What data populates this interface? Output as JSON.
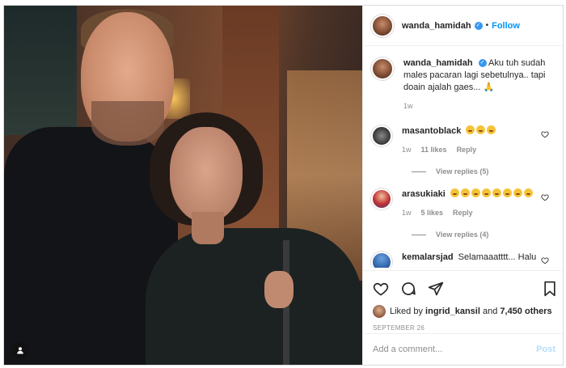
{
  "post": {
    "username": "wanda_hamidah",
    "follow_label": "Follow",
    "dot": "•"
  },
  "caption": {
    "username": "wanda_hamidah",
    "text": "Aku tuh sudah males pacaran lagi sebetulnya.. tapi doain ajalah gaes...",
    "emoji": "🙏",
    "time": "1w"
  },
  "comments": [
    {
      "username": "masantoblack",
      "emoji_count": 3,
      "time": "1w",
      "likes": "11 likes",
      "reply": "Reply",
      "view_replies": "View replies (5)"
    },
    {
      "username": "arasukiaki",
      "emoji_count": 8,
      "time": "1w",
      "likes": "5 likes",
      "reply": "Reply",
      "view_replies": "View replies (4)"
    },
    {
      "username": "kemalarsjad",
      "text": "Selamaaatttt... Halu"
    }
  ],
  "likes": {
    "prefix": "Liked by",
    "user": "ingrid_kansil",
    "conj": "and",
    "others": "7,450 others"
  },
  "date": "SEPTEMBER 26",
  "add_comment": {
    "placeholder": "Add a comment...",
    "post_label": "Post"
  },
  "colors": {
    "accent": "#0095f6",
    "verified": "#3897f0",
    "muted": "#8e8e8e"
  }
}
